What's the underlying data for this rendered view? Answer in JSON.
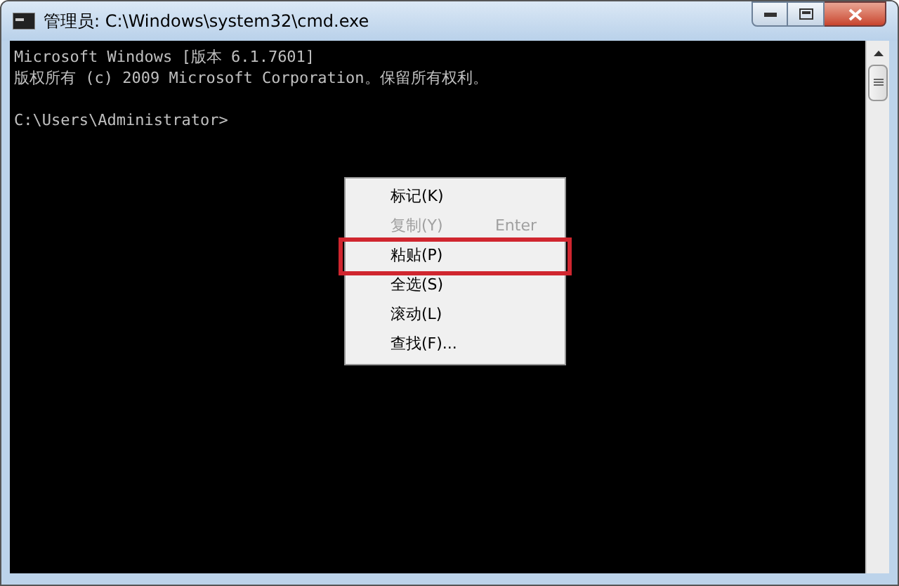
{
  "window": {
    "title": "管理员: C:\\Windows\\system32\\cmd.exe"
  },
  "console": {
    "banner": [
      "Microsoft Windows [版本 6.1.7601]",
      "版权所有 (c) 2009 Microsoft Corporation。保留所有权利。"
    ],
    "prompt": "C:\\Users\\Administrator>"
  },
  "context_menu": {
    "items": [
      {
        "label": "标记(K)",
        "disabled": false,
        "highlighted": false
      },
      {
        "label": "复制(Y)",
        "shortcut": "Enter",
        "disabled": true,
        "highlighted": false
      },
      {
        "label": "粘贴(P)",
        "disabled": false,
        "highlighted": true
      },
      {
        "label": "全选(S)",
        "disabled": false,
        "highlighted": false
      },
      {
        "label": "滚动(L)",
        "disabled": false,
        "highlighted": false
      },
      {
        "label": "查找(F)...",
        "disabled": false,
        "highlighted": false
      }
    ]
  }
}
